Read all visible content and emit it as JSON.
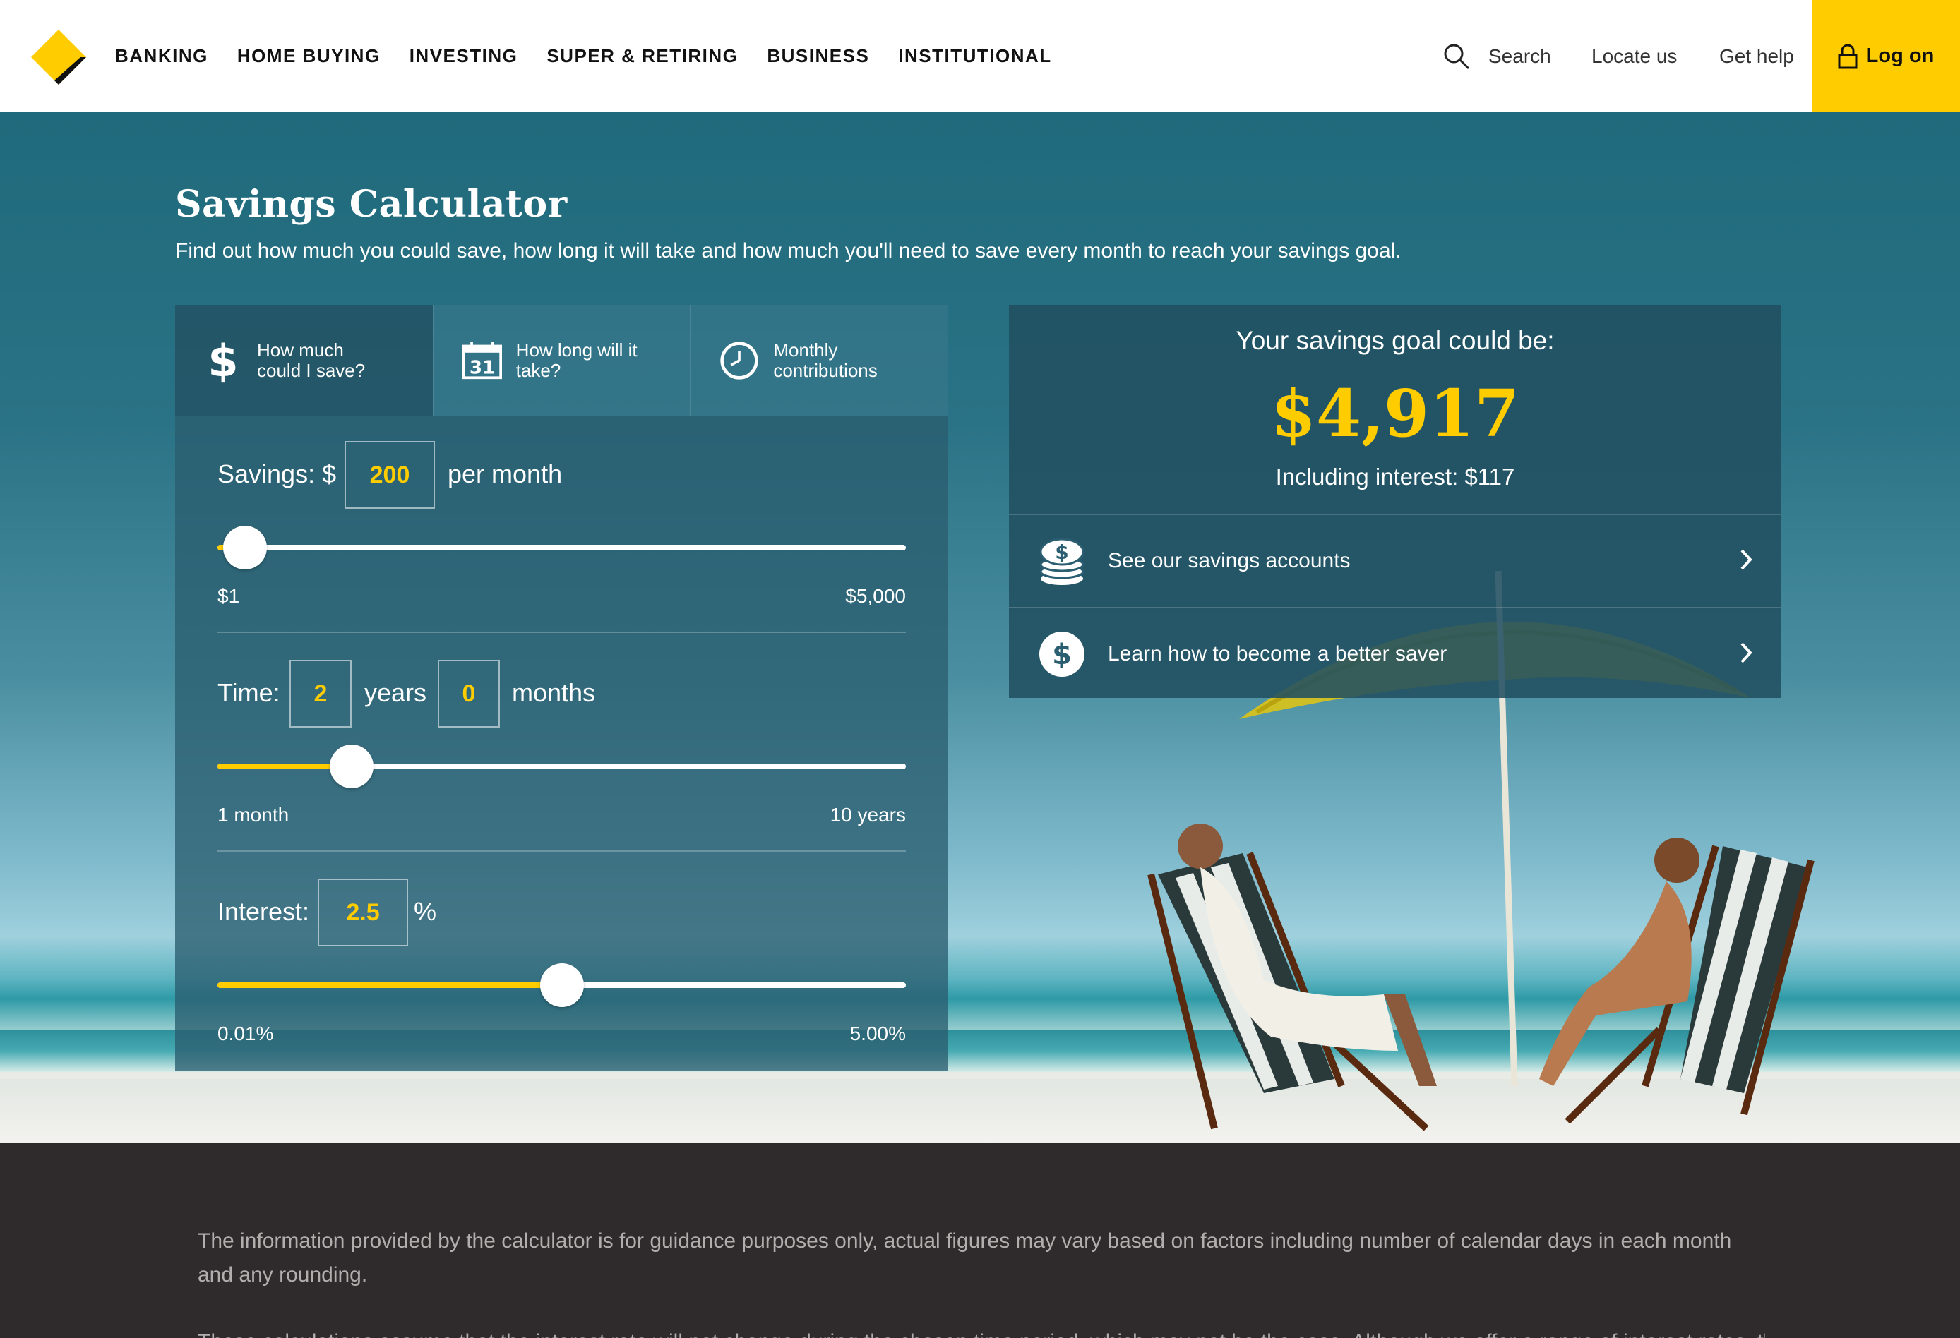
{
  "header": {
    "nav": [
      "BANKING",
      "HOME BUYING",
      "INVESTING",
      "SUPER & RETIRING",
      "BUSINESS",
      "INSTITUTIONAL"
    ],
    "search_label": "Search",
    "locate_label": "Locate us",
    "help_label": "Get help",
    "logon_label": "Log on"
  },
  "page": {
    "title": "Savings Calculator",
    "subtitle": "Find out how much you could save, how long it will take and how much you'll need to save every month to reach your savings goal."
  },
  "calculator": {
    "tabs": [
      {
        "line1": "How much",
        "line2": "could I save?",
        "icon": "dollar-icon",
        "active": true
      },
      {
        "line1": "How long will it",
        "line2": "take?",
        "icon": "calendar-icon",
        "active": false
      },
      {
        "line1": "Monthly",
        "line2": "contributions",
        "icon": "clock-icon",
        "active": false
      }
    ],
    "savings": {
      "label": "Savings: $",
      "value": "200",
      "suffix": "per month",
      "min": "$1",
      "max": "$5,000",
      "level": 0.04
    },
    "time": {
      "label": "Time:",
      "years": "2",
      "years_label": "years",
      "months": "0",
      "months_label": "months",
      "min": "1 month",
      "max": "10 years",
      "level": 0.195
    },
    "interest": {
      "label": "Interest:",
      "value": "2.5",
      "suffix": "%",
      "min": "0.01%",
      "max": "5.00%",
      "level": 0.5
    }
  },
  "result": {
    "label": "Your savings goal could be:",
    "value": "$4,917",
    "interest": "Including interest: $117",
    "links": [
      {
        "label": "See our savings accounts",
        "icon": "coins-icon"
      },
      {
        "label": "Learn how to become a better saver",
        "icon": "dollar-circle-icon"
      }
    ]
  },
  "footer": {
    "disclaimer": "The information provided by the calculator is for guidance purposes only, actual figures may vary based on factors including number of calendar days in each month and any rounding.",
    "disclaimer2": "These calculations assume that the interest rate will not change during the chosen time period, which may not be the case. Although we offer a range of interest rates, the"
  },
  "colors": {
    "accent": "#ffcc00",
    "panel": "#2a5e70",
    "footer": "#2f2a2b"
  }
}
